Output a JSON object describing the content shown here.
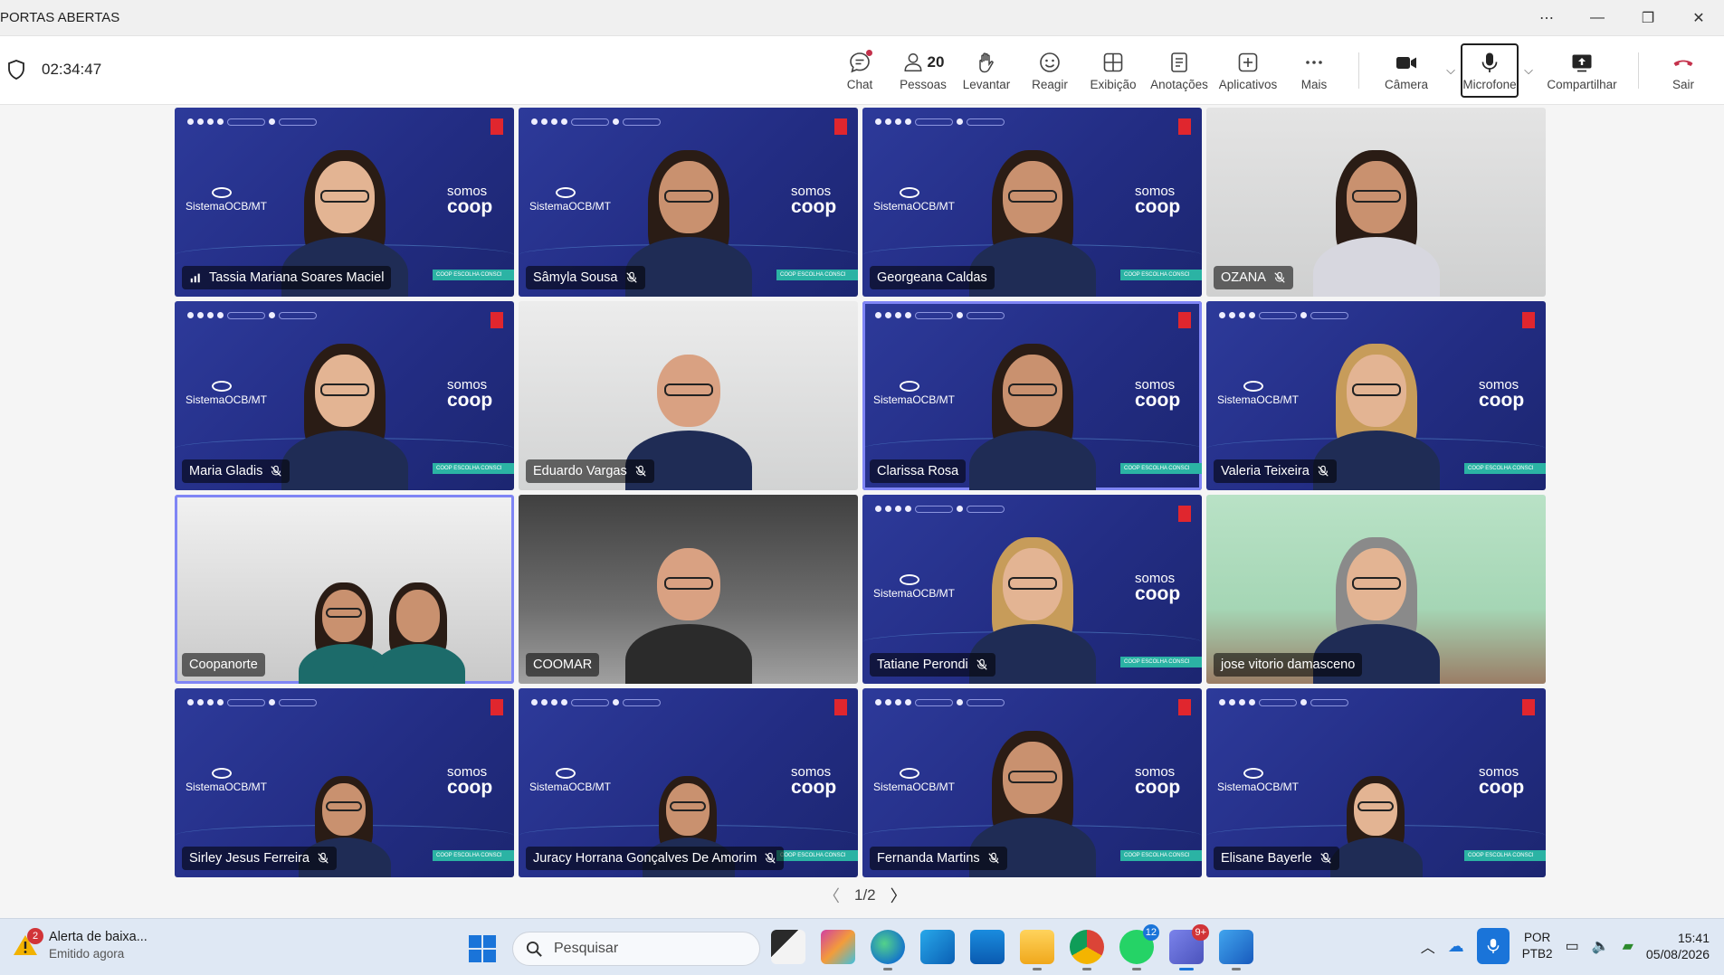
{
  "window": {
    "title": "PORTAS ABERTAS"
  },
  "meeting": {
    "timer": "02:34:47"
  },
  "toolbar": {
    "chat": "Chat",
    "people_count": "20",
    "people": "Pessoas",
    "raise": "Levantar",
    "react": "Reagir",
    "view": "Exibição",
    "notes": "Anotações",
    "apps": "Aplicativos",
    "more": "Mais",
    "camera": "Câmera",
    "mic": "Microfone",
    "share": "Compartilhar",
    "leave": "Sair"
  },
  "background": {
    "brand": "SistemaOCB/MT",
    "somos": "somos",
    "coop": "coop",
    "stripe": "COOP  ESCOLHA CONSCI"
  },
  "participants": [
    {
      "name": "Tassia Mariana Soares Maciel",
      "status": "speaking"
    },
    {
      "name": "Sâmyla Sousa",
      "status": "muted"
    },
    {
      "name": "Georgeana Caldas",
      "status": ""
    },
    {
      "name": "OZANA",
      "status": "muted"
    },
    {
      "name": "Maria Gladis",
      "status": "muted"
    },
    {
      "name": "Eduardo Vargas",
      "status": "muted"
    },
    {
      "name": "Clarissa Rosa",
      "status": ""
    },
    {
      "name": "Valeria Teixeira",
      "status": "muted"
    },
    {
      "name": "Coopanorte",
      "status": ""
    },
    {
      "name": "COOMAR",
      "status": ""
    },
    {
      "name": "Tatiane Perondi",
      "status": "muted"
    },
    {
      "name": "jose vitorio damasceno",
      "status": ""
    },
    {
      "name": "Sirley Jesus Ferreira",
      "status": "muted"
    },
    {
      "name": "Juracy Horrana Gonçalves De Amorim",
      "status": "muted"
    },
    {
      "name": "Fernanda Martins",
      "status": "muted"
    },
    {
      "name": "Elisane Bayerle",
      "status": "muted"
    }
  ],
  "pager": {
    "label": "1/2"
  },
  "taskbar": {
    "alert_count": "2",
    "alert_title": "Alerta de baixa...",
    "alert_sub": "Emitido agora",
    "search": "Pesquisar",
    "whatsapp_badge": "12",
    "teams_badge": "9+",
    "lang1": "POR",
    "lang2": "PTB2",
    "time": "15:41",
    "date": "05/08/2026"
  }
}
